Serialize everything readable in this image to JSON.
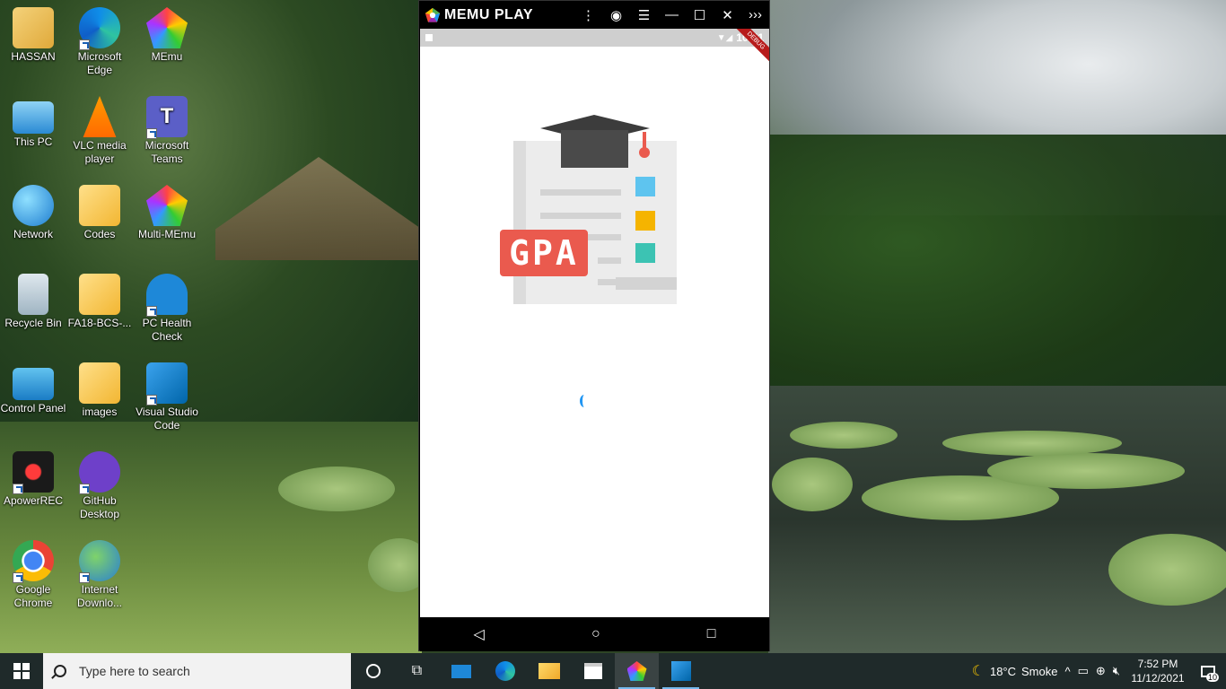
{
  "desktop": {
    "icons": [
      {
        "label": "HASSAN",
        "icon": "user-folder-icon"
      },
      {
        "label": "Microsoft Edge",
        "icon": "edge-icon"
      },
      {
        "label": "MEmu",
        "icon": "memu-icon"
      },
      {
        "label": "This PC",
        "icon": "computer-icon"
      },
      {
        "label": "VLC media player",
        "icon": "vlc-icon"
      },
      {
        "label": "Microsoft Teams",
        "icon": "teams-icon"
      },
      {
        "label": "Network",
        "icon": "network-icon"
      },
      {
        "label": "Codes",
        "icon": "folder-icon"
      },
      {
        "label": "Multi-MEmu",
        "icon": "multi-memu-icon"
      },
      {
        "label": "Recycle Bin",
        "icon": "recycle-bin-icon"
      },
      {
        "label": "FA18-BCS-...",
        "icon": "folder-icon"
      },
      {
        "label": "PC Health Check",
        "icon": "health-check-icon"
      },
      {
        "label": "Control Panel",
        "icon": "control-panel-icon"
      },
      {
        "label": "images",
        "icon": "folder-icon"
      },
      {
        "label": "Visual Studio Code",
        "icon": "vscode-icon"
      },
      {
        "label": "ApowerREC",
        "icon": "apowerrec-icon"
      },
      {
        "label": "GitHub Desktop",
        "icon": "github-icon"
      },
      {
        "label": "Google Chrome",
        "icon": "chrome-icon"
      },
      {
        "label": "Internet Downlo...",
        "icon": "idm-icon"
      }
    ]
  },
  "memu": {
    "title": "MEMU PLAY",
    "controls": [
      "menu-dots-icon",
      "account-icon",
      "hamburger-icon",
      "minimize-icon",
      "maximize-icon",
      "close-icon",
      "expand-icon"
    ],
    "statusbar": {
      "time": "10:51",
      "banner": "DEBUG"
    },
    "splash": {
      "badge_text": "GPA",
      "accent": "#ea5a4e"
    }
  },
  "taskbar": {
    "search_placeholder": "Type here to search",
    "weather": {
      "temp": "18°C",
      "condition": "Smoke"
    },
    "clock": {
      "time": "7:52 PM",
      "date": "11/12/2021"
    },
    "notification_count": "10"
  }
}
